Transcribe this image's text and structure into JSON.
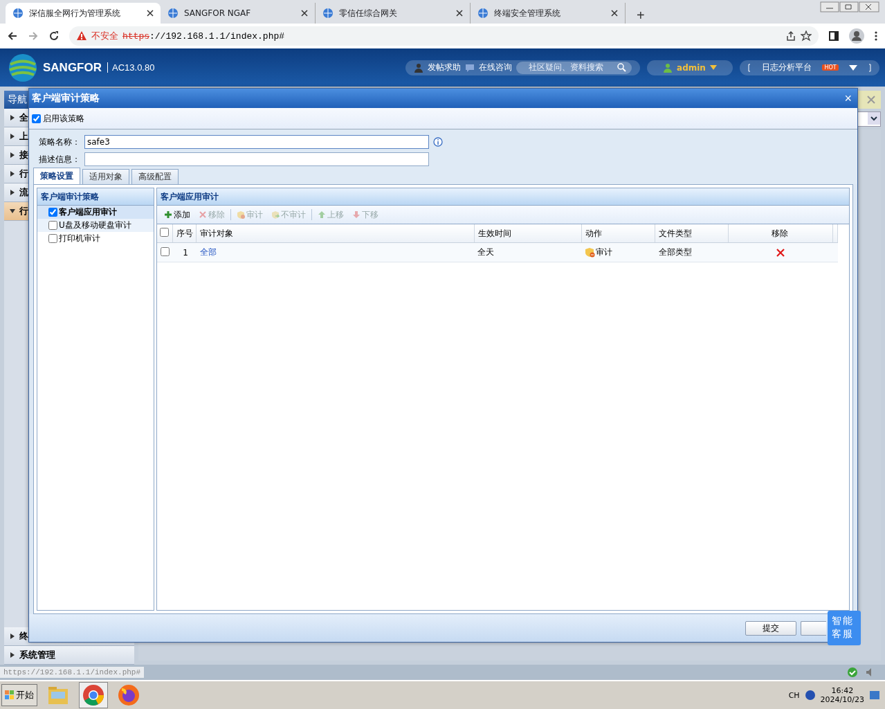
{
  "browser": {
    "tabs": [
      {
        "title": "深信服全网行为管理系统",
        "selected": true
      },
      {
        "title": "SANGFOR NGAF",
        "selected": false
      },
      {
        "title": "零信任综合网关",
        "selected": false
      },
      {
        "title": "终端安全管理系统",
        "selected": false
      }
    ],
    "new_tab": "+",
    "security": "不安全",
    "url_scheme": "https",
    "url_rest": "://192.168.1.1/index.php#"
  },
  "app_header": {
    "brand": "SANGFOR",
    "version": "AC13.0.80",
    "links": [
      "发帖求助",
      "在线咨询"
    ],
    "search_placeholder": "社区疑问、资料搜索",
    "user": "admin",
    "log_platform": "日志分析平台",
    "hot": "HOT"
  },
  "nav": {
    "title": "导航",
    "items": [
      {
        "label": "全",
        "expanded": false
      },
      {
        "label": "上",
        "expanded": false
      },
      {
        "label": "接",
        "expanded": false
      },
      {
        "label": "行",
        "expanded": false
      },
      {
        "label": "流",
        "expanded": false
      },
      {
        "label": "行",
        "expanded": true
      }
    ],
    "bottom_items": [
      {
        "label": "终",
        "expanded": false
      },
      {
        "label": "系统管理",
        "expanded": false
      }
    ]
  },
  "dialog": {
    "title": "客户端审计策略",
    "close": "×",
    "enable": {
      "label": "启用该策略",
      "checked": true
    },
    "fields": [
      {
        "label": "策略名称：",
        "value": "safe3"
      },
      {
        "label": "描述信息："
      }
    ],
    "tabs": [
      {
        "label": "策略设置",
        "selected": true
      },
      {
        "label": "适用对象",
        "selected": false
      },
      {
        "label": "高级配置",
        "selected": false
      }
    ],
    "policy_panel": {
      "title": "客户端审计策略",
      "items": [
        {
          "label": "客户端应用审计",
          "checked": true,
          "selected": true
        },
        {
          "label": "U盘及移动硬盘审计",
          "checked": false,
          "selected": false
        },
        {
          "label": "打印机审计",
          "checked": false,
          "selected": false
        }
      ]
    },
    "audit_panel": {
      "title": "客户端应用审计",
      "toolbar": [
        {
          "kind": "add",
          "label": "添加",
          "disabled": false
        },
        {
          "kind": "remove",
          "label": "移除",
          "disabled": true
        },
        {
          "kind": "audit",
          "label": "审计",
          "disabled": true
        },
        {
          "kind": "noaudit",
          "label": "不审计",
          "disabled": true
        },
        {
          "kind": "up",
          "label": "上移",
          "disabled": true
        },
        {
          "kind": "down",
          "label": "下移",
          "disabled": true
        }
      ],
      "all_checked": false,
      "columns": [
        "序号",
        "审计对象",
        "生效时间",
        "动作",
        "文件类型",
        "移除"
      ],
      "rows": [
        {
          "checked": false,
          "index": "1",
          "object": "全部",
          "time": "全天",
          "action": "审计",
          "file_type": "全部类型"
        }
      ]
    },
    "buttons": [
      "提交"
    ]
  },
  "assistant": "智能客服",
  "status_bar": {
    "url": "https://192.168.1.1/index.php#"
  },
  "taskbar": {
    "start": "开始",
    "tray_lang": "CH",
    "time": "16:42",
    "date": "2024/10/23"
  }
}
